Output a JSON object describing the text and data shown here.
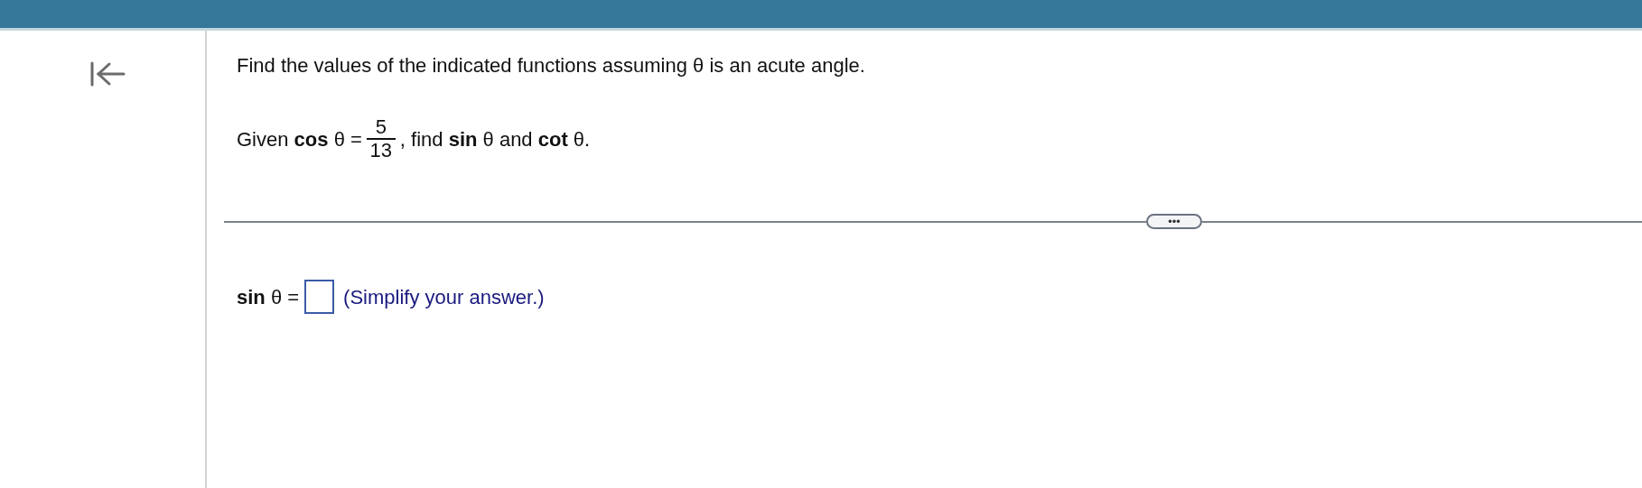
{
  "question": {
    "instruction": "Find the values of the indicated functions assuming θ is an acute angle.",
    "given": {
      "lead": "Given **cos** θ =",
      "numerator": "5",
      "denominator": "13",
      "tail": ", find **sin** θ and **cot** θ."
    }
  },
  "more_button": {
    "label": "•••"
  },
  "answer": {
    "label": "**sin** θ =",
    "hint": "(Simplify your answer.)"
  }
}
